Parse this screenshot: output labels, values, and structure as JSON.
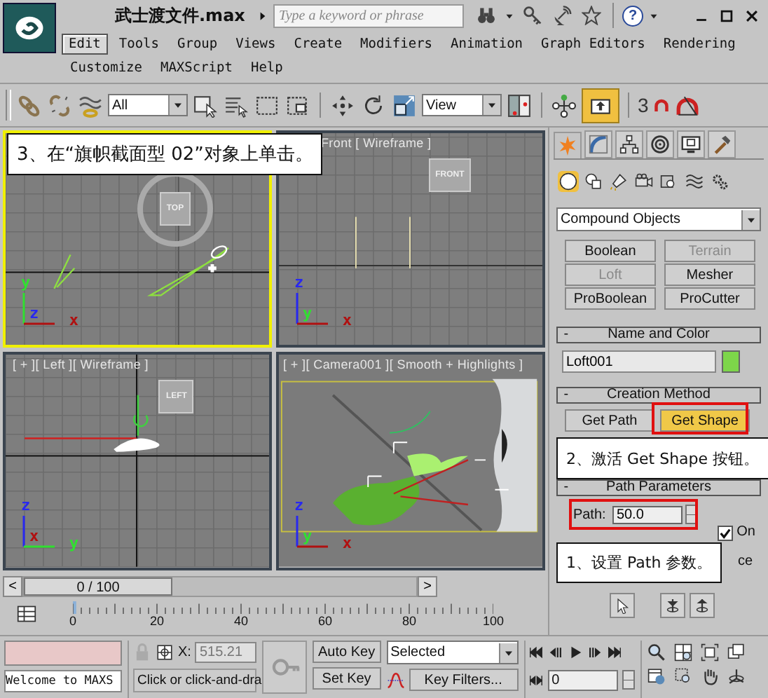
{
  "window": {
    "title": "武士渡文件.max",
    "search_placeholder": "Type a keyword or phrase",
    "help": "?"
  },
  "menu_rows": [
    [
      {
        "label": "Edit",
        "selected": true
      },
      {
        "label": "Tools",
        "selected": false
      },
      {
        "label": "Group",
        "selected": false
      },
      {
        "label": "Views",
        "selected": false
      },
      {
        "label": "Create",
        "selected": false
      },
      {
        "label": "Modifiers",
        "selected": false
      },
      {
        "label": "Animation",
        "selected": false
      },
      {
        "label": "Graph Editors",
        "selected": false
      },
      {
        "label": "Rendering",
        "selected": false
      }
    ],
    [
      {
        "label": "Customize",
        "selected": false
      },
      {
        "label": "MAXScript",
        "selected": false
      },
      {
        "label": "Help",
        "selected": false
      }
    ]
  ],
  "toolbar": {
    "selection_filter": "All",
    "coordinate_system": "View",
    "snap_label": "3",
    "keyboard_override_on": true
  },
  "viewports": [
    {
      "kind": "top",
      "active": true,
      "cube": "TOP",
      "axes": [
        {
          "label": "y",
          "color": "#30e030"
        },
        {
          "label": "x",
          "color": "#b01010"
        },
        {
          "label": "z",
          "color": "#2828f0"
        }
      ]
    },
    {
      "kind": "front",
      "label": "Front [ Wireframe ]",
      "active": false,
      "cube": "FRONT",
      "axes": [
        {
          "label": "z",
          "color": "#2828f0"
        },
        {
          "label": "x",
          "color": "#b01010"
        },
        {
          "label": "y",
          "color": "#30e030"
        }
      ]
    },
    {
      "kind": "left",
      "label": "[ + ][ Left ][ Wireframe ]",
      "active": false,
      "cube": "LEFT",
      "axes": [
        {
          "label": "z",
          "color": "#2828f0"
        },
        {
          "label": "y",
          "color": "#30e030"
        },
        {
          "label": "x",
          "color": "#b01010"
        }
      ]
    },
    {
      "kind": "camera",
      "label": "[ + ][ Camera001 ][ Smooth + Highlights ]",
      "active": false,
      "axes": [
        {
          "label": "z",
          "color": "#2828f0"
        },
        {
          "label": "x",
          "color": "#b01010"
        },
        {
          "label": "y",
          "color": "#30e030"
        }
      ]
    }
  ],
  "command_panel": {
    "category": "Compound Objects",
    "object_types": [
      {
        "label": "Boolean",
        "disabled": false
      },
      {
        "label": "Terrain",
        "disabled": true
      },
      {
        "label": "Loft",
        "disabled": true
      },
      {
        "label": "Mesher",
        "disabled": false
      },
      {
        "label": "ProBoolean",
        "disabled": false
      },
      {
        "label": "ProCutter",
        "disabled": false
      }
    ],
    "name_color": {
      "toggle": "-",
      "title": "Name and Color",
      "name": "Loft001",
      "color": "#7dd64a"
    },
    "creation_method": {
      "toggle": "-",
      "title": "Creation Method",
      "buttons": [
        {
          "label": "Get Path",
          "selected": false
        },
        {
          "label": "Get Shape",
          "selected": true
        }
      ]
    },
    "path_parameters": {
      "toggle": "-",
      "title": "Path Parameters",
      "path_label": "Path:",
      "path_value": "50.0",
      "snap_on": {
        "label": "On",
        "checked": true
      },
      "fragment": "ce"
    }
  },
  "annotations": [
    "3、在“旗帜截面型 02”对象上单击。",
    "2、激活 Get Shape 按钮。",
    "1、设置 Path 参数。"
  ],
  "time_slider": {
    "prev": "<",
    "position": "0 / 100",
    "next": ">"
  },
  "track_ticks": [
    "0",
    "20",
    "40",
    "60",
    "80",
    "100"
  ],
  "status": {
    "listener": "Welcome to MAXS",
    "x_label": "X:",
    "x_value": "515.21",
    "prompt": "Click or click-and-dra",
    "auto_key": "Auto Key",
    "set_key": "Set Key",
    "key_set": "Selected",
    "key_filters": "Key Filters...",
    "frame": "0"
  }
}
